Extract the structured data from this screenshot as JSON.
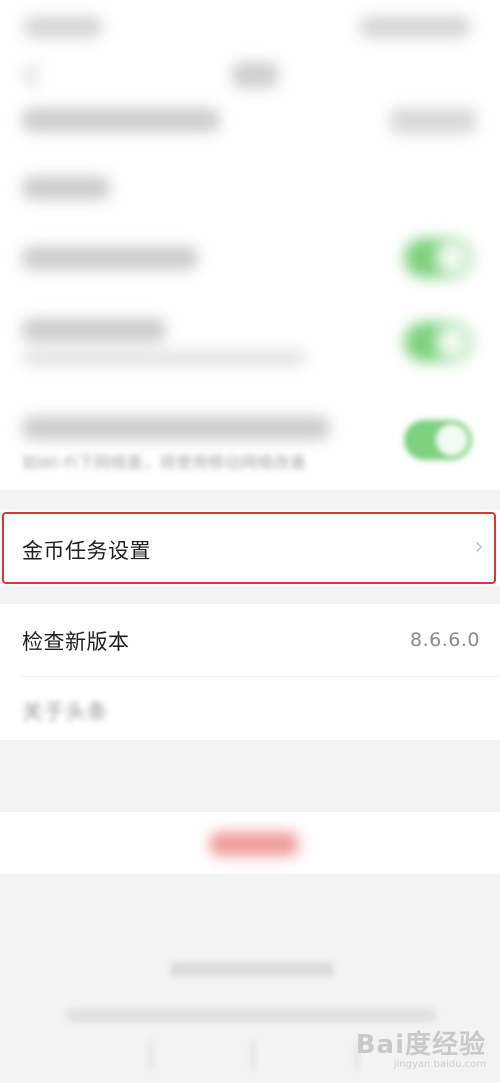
{
  "settings": {
    "wifi_note": "如Wi-Fi下网络差，将使用移动网络改善",
    "coin_task": {
      "label": "金币任务设置"
    },
    "update": {
      "label": "检查新版本",
      "version": "8.6.6.0"
    },
    "about": {
      "label": "关于头条"
    }
  },
  "watermark": {
    "logo": "Bai度经验",
    "url": "jingyan.baidu.com"
  },
  "colors": {
    "toggle_on": "#7ed17e",
    "highlight_border": "#d93535",
    "logout_text": "#ef9a9a",
    "page_bg": "#f3f3f3"
  },
  "icons": {
    "back": "back-arrow-icon",
    "row_chevron": "chevron-right-icon"
  },
  "toggles": [
    {
      "on": true
    },
    {
      "on": true
    },
    {
      "on": true
    }
  ]
}
